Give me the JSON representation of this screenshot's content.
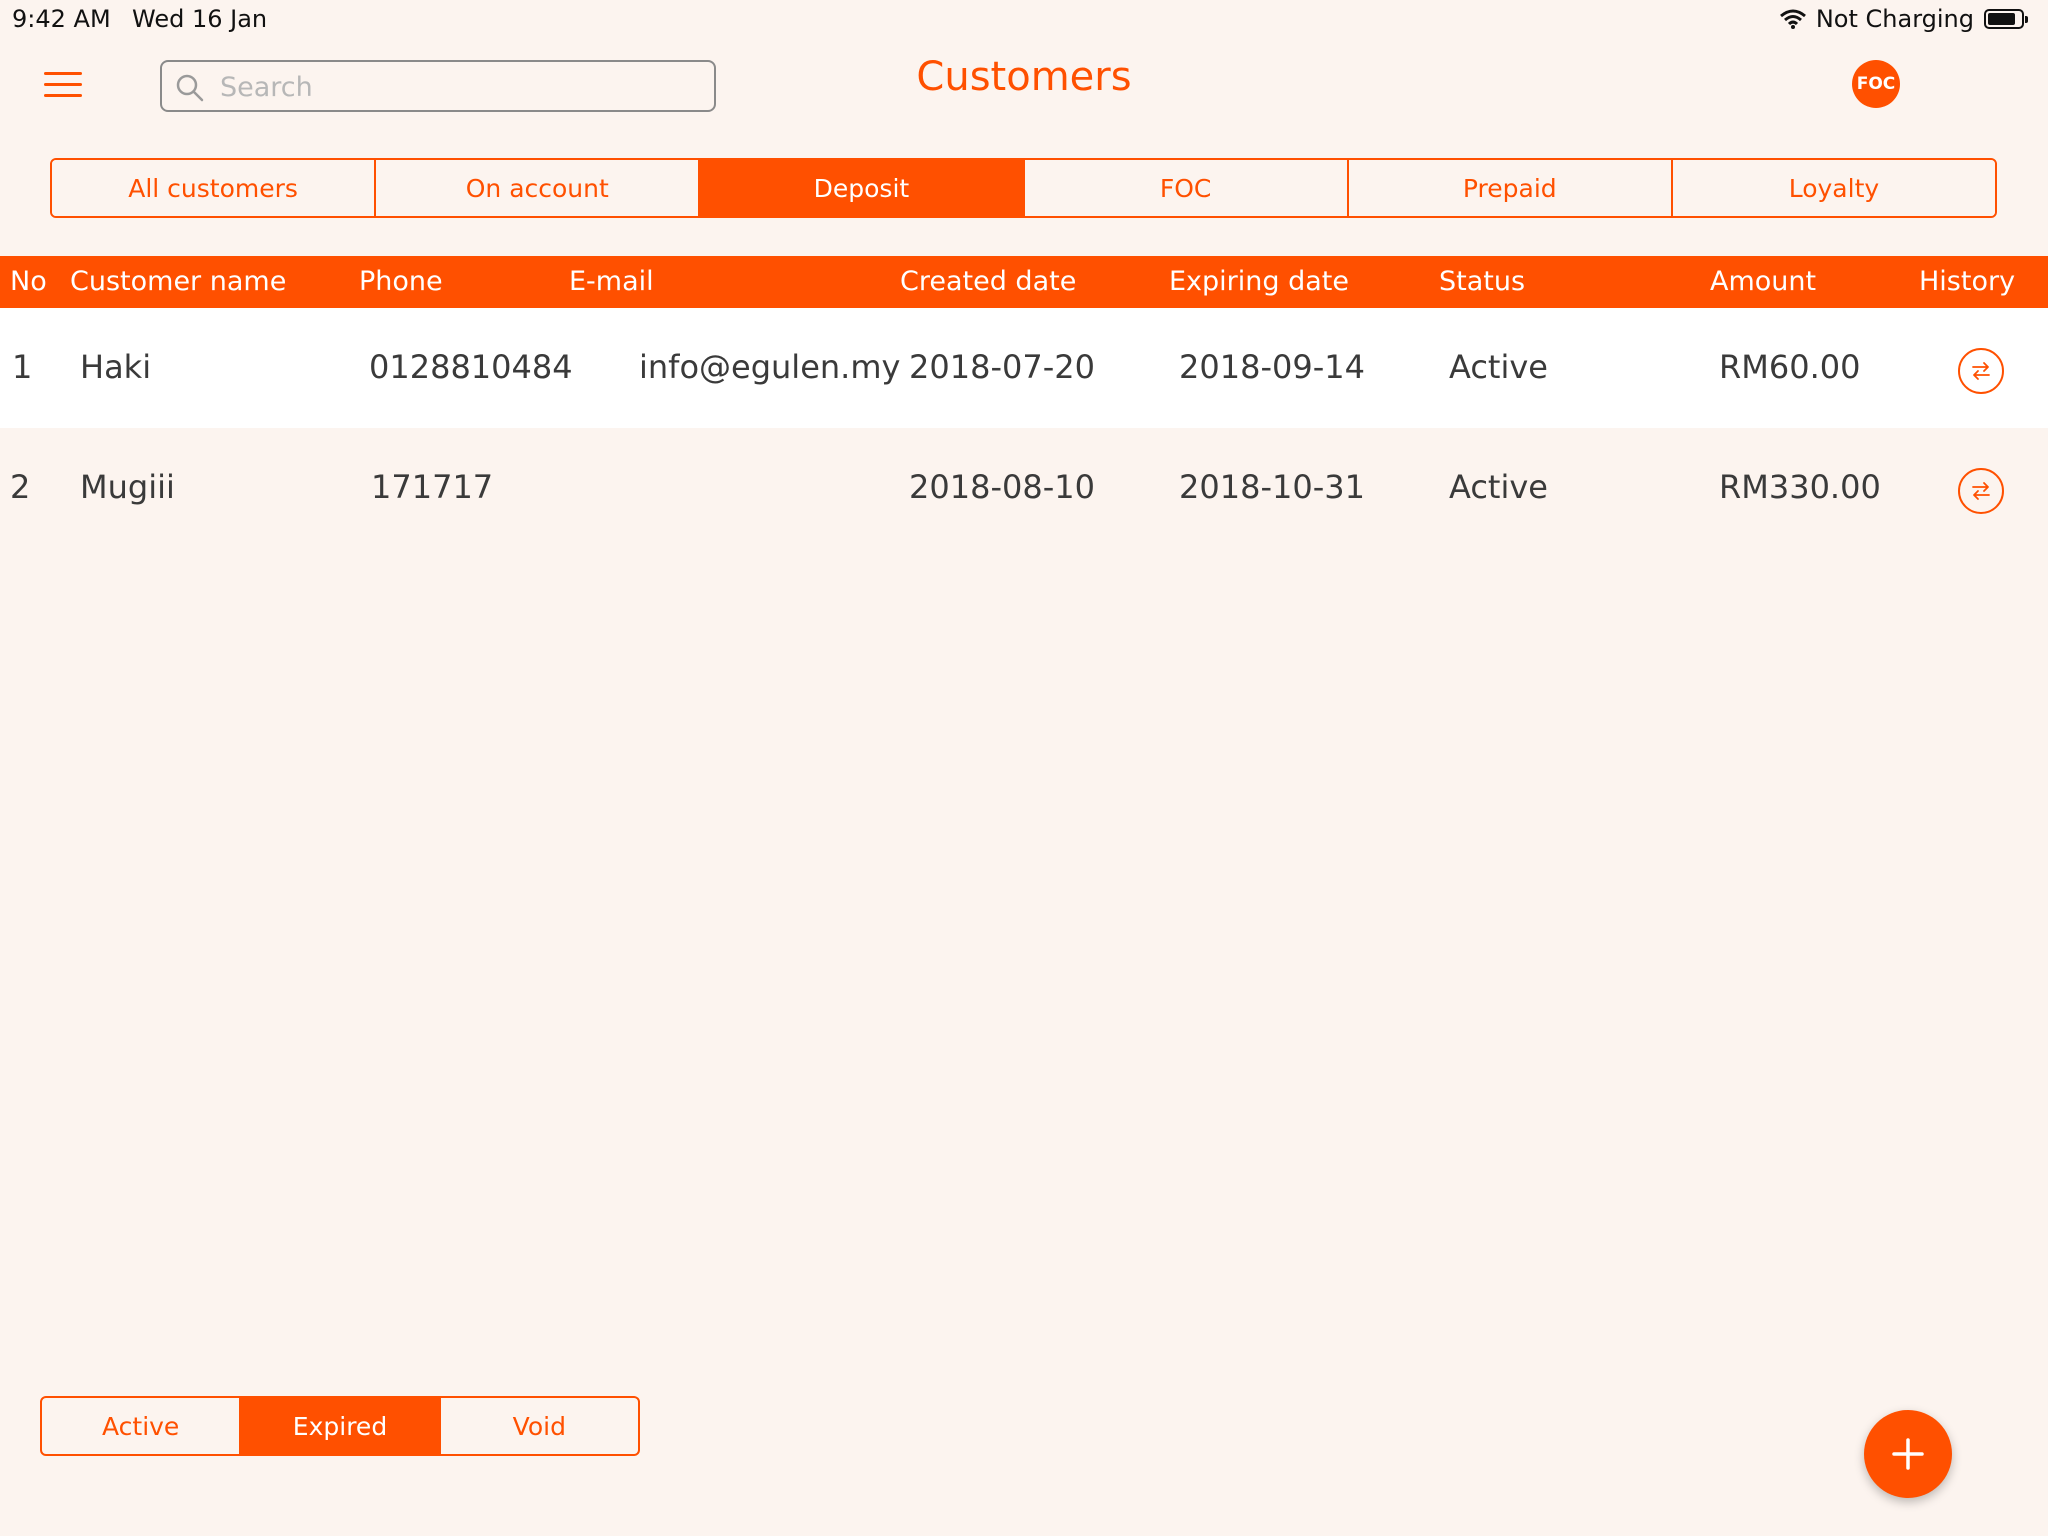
{
  "status_bar": {
    "time": "9:42 AM",
    "date": "Wed 16 Jan",
    "charging": "Not Charging",
    "battery_level": 0.85
  },
  "header": {
    "title": "Customers",
    "search_placeholder": "Search",
    "avatar_text": "FOC"
  },
  "tabs": [
    {
      "label": "All customers",
      "active": false
    },
    {
      "label": "On account",
      "active": false
    },
    {
      "label": "Deposit",
      "active": true
    },
    {
      "label": "FOC",
      "active": false
    },
    {
      "label": "Prepaid",
      "active": false
    },
    {
      "label": "Loyalty",
      "active": false
    }
  ],
  "table": {
    "columns": [
      "No",
      "Customer name",
      "Phone",
      "E-mail",
      "Created date",
      "Expiring date",
      "Status",
      "Amount",
      "History"
    ],
    "rows": [
      {
        "no": "1",
        "name": "Haki",
        "phone": "0128810484",
        "email": "info@egulen.my",
        "created": "2018-07-20",
        "expiring": "2018-09-14",
        "status": "Active",
        "amount": "RM60.00"
      },
      {
        "no": "2",
        "name": "Mugiii",
        "phone": "171717",
        "email": "",
        "created": "2018-08-10",
        "expiring": "2018-10-31",
        "status": "Active",
        "amount": "RM330.00"
      }
    ]
  },
  "status_filter": [
    {
      "label": "Active",
      "active": false
    },
    {
      "label": "Expired",
      "active": true
    },
    {
      "label": "Void",
      "active": false
    }
  ],
  "icons": {
    "menu": "hamburger-menu-icon",
    "search": "search-icon",
    "history": "swap-arrows-icon",
    "add": "plus-icon",
    "wifi": "wifi-icon",
    "battery": "battery-icon"
  },
  "colors": {
    "accent": "#ff5000",
    "background": "#fcf4ef",
    "text": "#3a3a3a"
  }
}
